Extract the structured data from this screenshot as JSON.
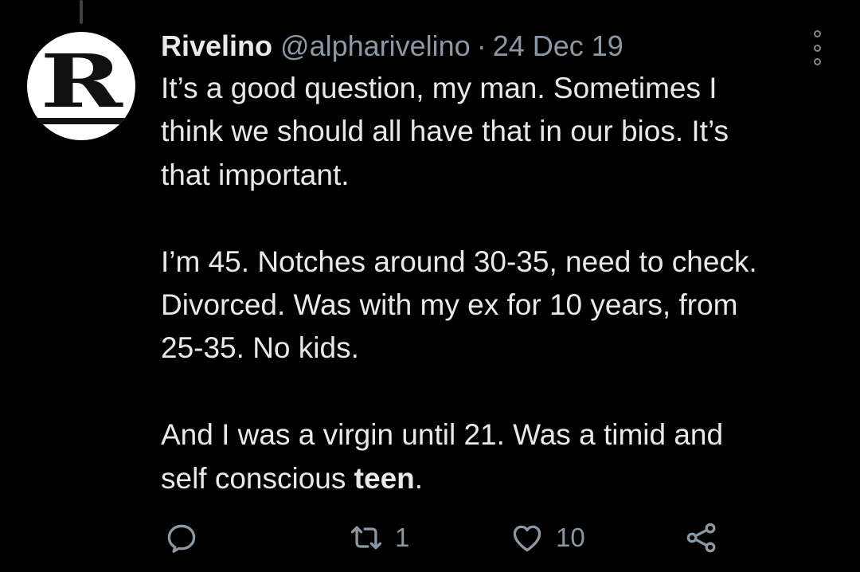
{
  "tweet": {
    "author_name": "Rivelino",
    "handle": "@alpharivelino",
    "separator": "·",
    "date": "24 Dec 19",
    "avatar_letter": "R",
    "paragraphs": [
      "It’s a good question, my man. Sometimes I\nthink we should all have that in our bios. It’s\nthat important.",
      "I’m 45. Notches around 30-35, need to check.\nDivorced. Was with my ex for 10 years, from\n25-35. No kids."
    ],
    "last_paragraph_lead": "And I was a virgin until 21. Was a timid and\nself conscious ",
    "last_paragraph_bold": "teen",
    "last_paragraph_tail": "."
  },
  "actions": {
    "reply_icon": "reply-icon",
    "retweet_icon": "retweet-icon",
    "retweet_count": "1",
    "like_icon": "heart-icon",
    "like_count": "10",
    "share_icon": "share-icon"
  },
  "colors": {
    "background": "#000000",
    "primary_text": "#e7e9ea",
    "secondary_text": "#8b98a5"
  }
}
